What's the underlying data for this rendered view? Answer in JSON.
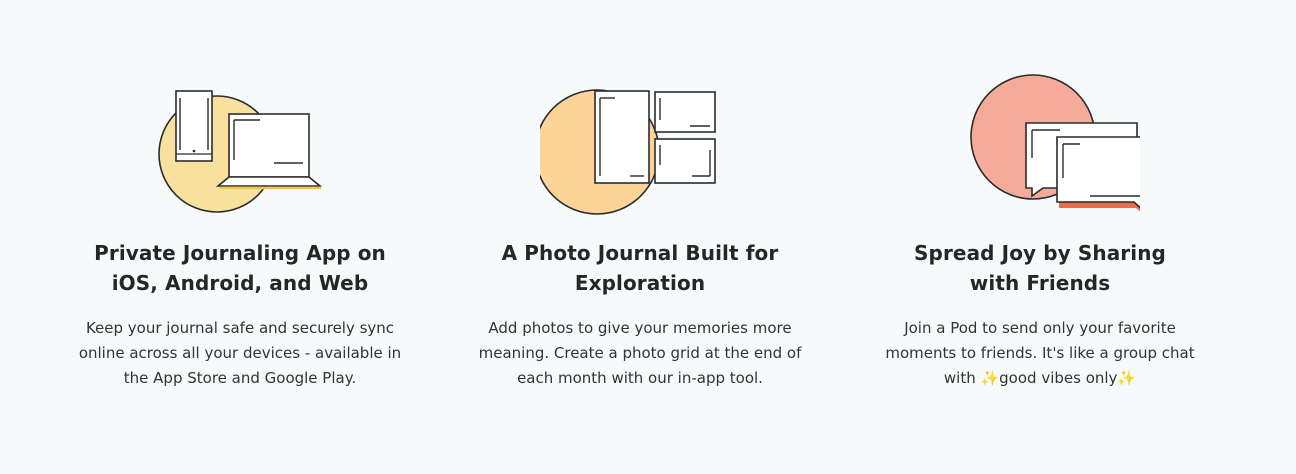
{
  "features": [
    {
      "title_lines": [
        "Private Journaling App on",
        "iOS, Android, and Web"
      ],
      "desc_lines": [
        "Keep your journal safe and securely sync",
        "online across all your devices - available in",
        "the App Store and Google Play."
      ],
      "icon": "devices-illustration",
      "accent": "#f8e19c"
    },
    {
      "title_lines": [
        "A Photo Journal Built for",
        "Exploration"
      ],
      "desc_lines": [
        "Add photos to give your memories more",
        "meaning. Create a photo grid at the end of",
        "each month with our in-app tool."
      ],
      "icon": "photo-grid-illustration",
      "accent": "#fdd497"
    },
    {
      "title_lines": [
        "Spread Joy by Sharing",
        "with Friends"
      ],
      "desc_lines": [
        "Join a Pod to send only your favorite",
        "moments to friends. It's like a group chat",
        "with ✨good vibes only✨"
      ],
      "icon": "chat-bubbles-illustration",
      "accent": "#f6ab9a"
    }
  ]
}
